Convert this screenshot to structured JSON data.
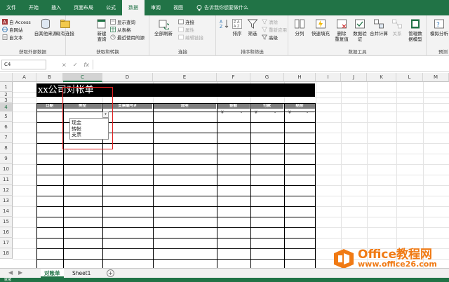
{
  "ribbon": {
    "tabs": [
      "文件",
      "开始",
      "插入",
      "页面布局",
      "公式",
      "数据",
      "审阅",
      "视图"
    ],
    "active_tab": "数据",
    "tellme": "告诉我你想要做什么",
    "groups": {
      "external": {
        "label": "获取外部数据",
        "access": "自 Access",
        "web": "自网站",
        "text": "自文本",
        "other": "自其他来源",
        "existing": "现有连接"
      },
      "transform": {
        "label": "获取和转换",
        "new_query": "新建\n查询",
        "show_queries": "显示查询",
        "from_table": "从表格",
        "recent": "最近使用的源"
      },
      "connections": {
        "label": "连接",
        "refresh": "全部刷新",
        "conn": "连接",
        "props": "属性",
        "edit_links": "编辑链接"
      },
      "sort": {
        "label": "排序和筛选",
        "sort": "排序",
        "filter": "筛选",
        "clear": "清除",
        "reapply": "重新应用",
        "advanced": "高级"
      },
      "tools": {
        "label": "数据工具",
        "split": "分列",
        "flash": "快速填充",
        "dedupe": "删除\n重复值",
        "validate": "数据验\n证",
        "consolidate": "合并计算",
        "relations": "关系",
        "model": "管理数\n据模型"
      },
      "forecast": {
        "label": "预测",
        "whatif": "模拟分析"
      }
    }
  },
  "formula_bar": {
    "name_box": "C4",
    "cancel": "×",
    "enter": "✓",
    "fx": "fx",
    "value": ""
  },
  "columns": [
    "A",
    "B",
    "C",
    "D",
    "E",
    "F",
    "G",
    "H",
    "I",
    "J",
    "K",
    "L",
    "M"
  ],
  "rows": [
    "1",
    "2",
    "3",
    "4",
    "5",
    "6",
    "7",
    "8",
    "9",
    "10",
    "11",
    "12",
    "13",
    "14",
    "15",
    "16",
    "17",
    "18"
  ],
  "sheet": {
    "title": "xx公司对帐单",
    "headers": [
      "日期",
      "类型",
      "支票编号#",
      "说明",
      "金额",
      "付款",
      "结余"
    ],
    "currency_symbol": "¥",
    "currency_dash": "-"
  },
  "dropdown": {
    "arrow": "▾",
    "options": [
      "现金",
      "转帐",
      "支票"
    ]
  },
  "sheet_tabs": {
    "tabs": [
      "对账单",
      "Sheet1"
    ],
    "active": "对账单",
    "add": "+"
  },
  "status": {
    "text": "就绪"
  },
  "watermark": {
    "brand": "Office教程网",
    "url": "www.office26.com"
  },
  "colors": {
    "accent": "#217346",
    "highlight_box": "#e02020",
    "watermark": "#f07a14"
  }
}
